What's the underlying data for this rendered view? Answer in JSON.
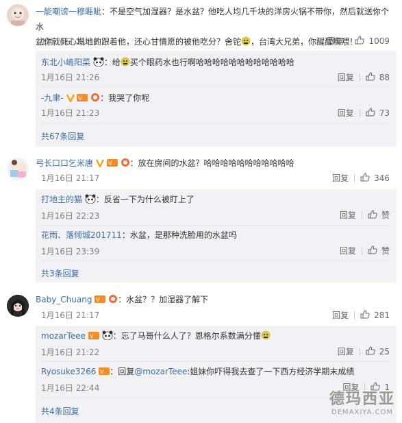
{
  "c1": {
    "user": "一能嘲谤一穆睚眦",
    "text_line1": "：不是空气加湿器？是水盆？他吃人均几千块的洋房火锅不带你，然后就送你个水",
    "text_line2": "盆你就死心塌地的跟着他，还心甘情愿的被他吃分？舍铊",
    "text_line2b": "，台湾大兄弟，你醒醒啊喂！",
    "time": "1月16日 21:18",
    "reply_label": "回复",
    "likes": "1009",
    "replies": [
      {
        "user": "东北小嶋阳菜",
        "text_a": "：给",
        "text_b": "买个眼药水也行啊哈哈哈哈哈哈哈哈哈哈哈哈",
        "time": "1月16日 21:26",
        "reply_label": "回复",
        "likes": "88"
      },
      {
        "user": "-九聿-",
        "text_a": "：我哭了你呢",
        "time": "1月16日 21:23",
        "reply_label": "回复",
        "likes": "73"
      }
    ],
    "more": "共67条回复"
  },
  "c2": {
    "user": "弓长口口乞米唐",
    "text": "：放在房间的水盆？哈哈哈哈哈哈哈哈哈哈哈",
    "time": "1月16日 21:17",
    "reply_label": "回复",
    "likes": "346",
    "replies": [
      {
        "user": "打地主的猫",
        "text_a": "：反省一下为什么被盯上了",
        "time": "1月16日 22:23",
        "reply_label": "回复",
        "likes": "赞"
      },
      {
        "user": "花雨、落倾城201711",
        "text_a": "：水盆，是那种洗脸用的水盆吗",
        "time": "1月16日 23:39",
        "reply_label": "回复",
        "likes": "赞"
      }
    ],
    "more": "共3条回复"
  },
  "c3": {
    "user": "Baby_Chuang",
    "text": "：水盆？？加湿器了解下",
    "time": "1月16日 21:17",
    "reply_label": "回复",
    "likes": "281",
    "replies": [
      {
        "user": "mozarTeee",
        "text_a": "：忘了马哥什么人了？恩格尔系数满分懂",
        "time": "1月16日 21:22",
        "reply_label": "回复",
        "likes": "25"
      },
      {
        "user": "Ryosuke3266",
        "text_a": "：回复",
        "mention": "@mozarTeee",
        "text_b": ":姐妹你吓得我去查了一下西方经济学期末成绩",
        "time": "1月16日 22:44",
        "reply_label": "回复",
        "likes": "1"
      }
    ],
    "more": "共4条回复"
  },
  "watermark": {
    "title": "德玛西亚",
    "sub": "DEMAXIYA.COM"
  },
  "colors": {
    "link": "#3a6ea5",
    "reply_bg": "#f2f2f5",
    "separator": "#e6e6e6",
    "muted": "#808080"
  }
}
